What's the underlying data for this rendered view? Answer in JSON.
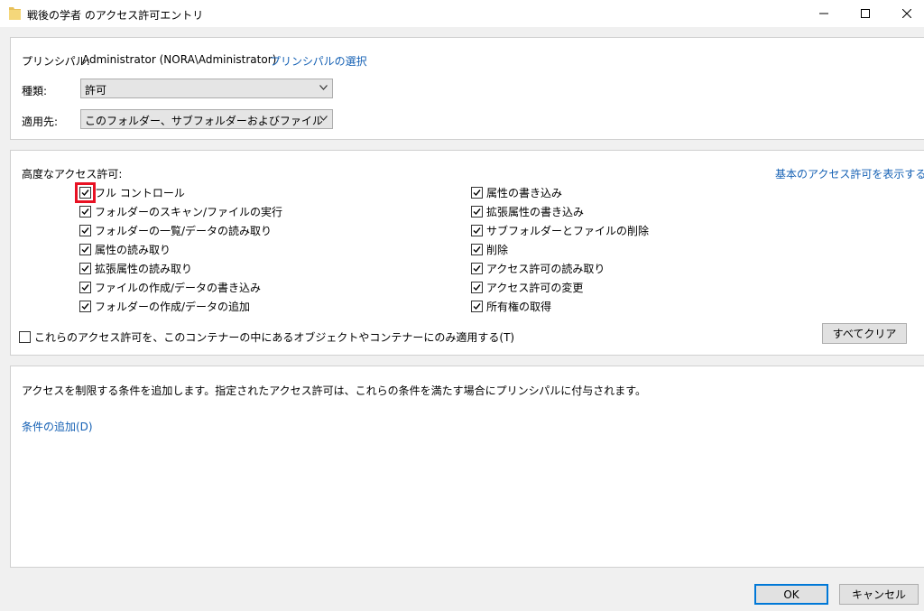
{
  "window": {
    "title": "戦後の学者 のアクセス許可エントリ"
  },
  "principal": {
    "label": "プリンシパル:",
    "value": "Administrator (NORA\\Administrator)",
    "select_link": "プリンシパルの選択"
  },
  "type": {
    "label": "種類:",
    "value": "許可"
  },
  "applies_to": {
    "label": "適用先:",
    "value": "このフォルダー、サブフォルダーおよびファイル"
  },
  "advanced": {
    "heading": "高度なアクセス許可:",
    "basic_link": "基本のアクセス許可を表示する",
    "left": [
      {
        "label": "フル コントロール",
        "checked": true
      },
      {
        "label": "フォルダーのスキャン/ファイルの実行",
        "checked": true
      },
      {
        "label": "フォルダーの一覧/データの読み取り",
        "checked": true
      },
      {
        "label": "属性の読み取り",
        "checked": true
      },
      {
        "label": "拡張属性の読み取り",
        "checked": true
      },
      {
        "label": "ファイルの作成/データの書き込み",
        "checked": true
      },
      {
        "label": "フォルダーの作成/データの追加",
        "checked": true
      }
    ],
    "right": [
      {
        "label": "属性の書き込み",
        "checked": true
      },
      {
        "label": "拡張属性の書き込み",
        "checked": true
      },
      {
        "label": "サブフォルダーとファイルの削除",
        "checked": true
      },
      {
        "label": "削除",
        "checked": true
      },
      {
        "label": "アクセス許可の読み取り",
        "checked": true
      },
      {
        "label": "アクセス許可の変更",
        "checked": true
      },
      {
        "label": "所有権の取得",
        "checked": true
      }
    ],
    "apply_only_label": "これらのアクセス許可を、このコンテナーの中にあるオブジェクトやコンテナーにのみ適用する(T)",
    "clear_all": "すべてクリア"
  },
  "conditions": {
    "description": "アクセスを制限する条件を追加します。指定されたアクセス許可は、これらの条件を満たす場合にプリンシパルに付与されます。",
    "add_link": "条件の追加(D)"
  },
  "footer": {
    "ok": "OK",
    "cancel": "キャンセル"
  },
  "colors": {
    "link": "#1460b4",
    "highlight": "#e81123",
    "default_button_border": "#0078d7"
  }
}
